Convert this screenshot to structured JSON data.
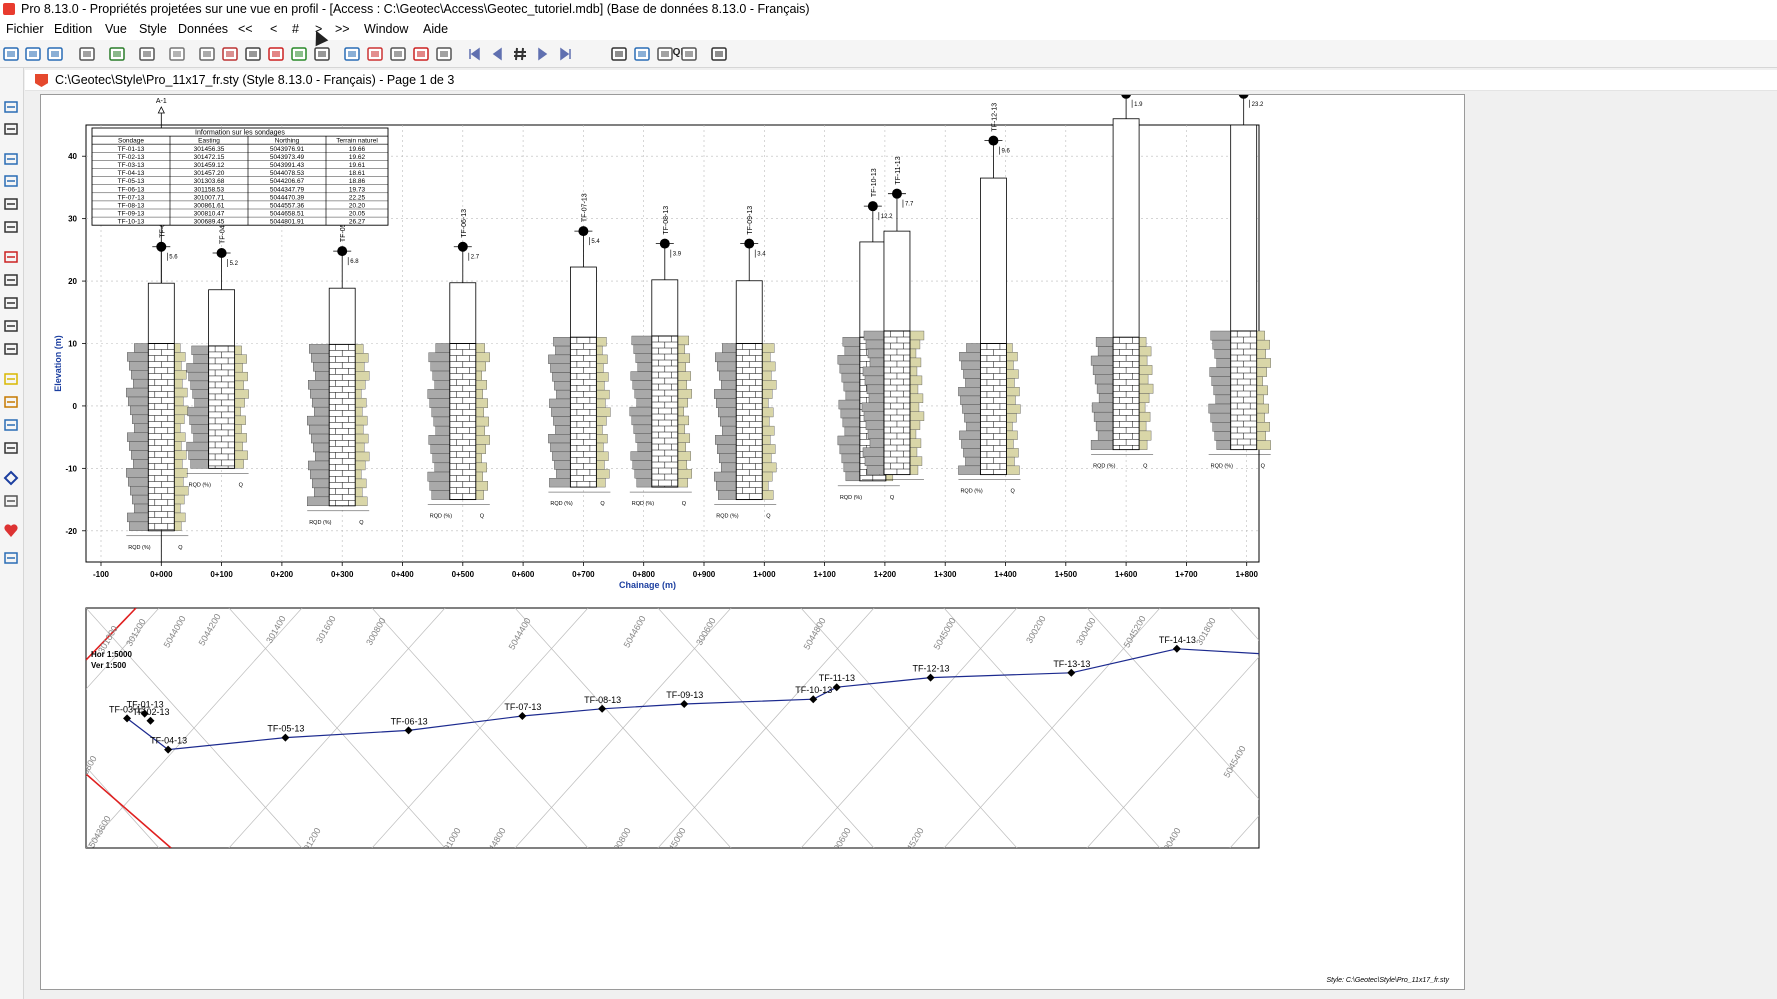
{
  "window": {
    "title": "Pro 8.13.0 - Propriétés projetées sur une vue en profil - [Access : C:\\Geotec\\Access\\Geotec_tutoriel.mdb] (Base de données 8.13.0 - Français)"
  },
  "menu": [
    "Fichier",
    "Edition",
    "Vue",
    "Style",
    "Données",
    "<<",
    "<",
    "#",
    ">",
    ">>",
    "Window",
    "Aide"
  ],
  "toolbar": {
    "icons": [
      "open-folder-icon",
      "database-icon",
      "database-link-icon",
      "print-icon",
      "refresh-icon",
      "chart-edit-icon",
      "table-icon",
      "hatch-icon",
      "curve-icon",
      "contour-icon",
      "bars-icon",
      "legend-icon",
      "cylinder-icon",
      "import-icon",
      "export-icon",
      "grid-icon",
      "zoom-region-icon",
      "dots-icon",
      "first-page-icon",
      "prev-page-icon",
      "page-number-icon",
      "next-page-icon",
      "last-page-icon",
      "sql-icon",
      "query-icon",
      "copy-icon",
      "clipboard-icon",
      "exit-icon"
    ],
    "sql_label": "SQL"
  },
  "document": {
    "title": "C:\\Geotec\\Style\\Pro_11x17_fr.sty (Style 8.13.0 - Français) - Page 1 de 3"
  },
  "chart_data": [
    {
      "type": "table",
      "title": "Information sur les sondages",
      "columns": [
        "Sondage",
        "Easting",
        "Northing",
        "Terrain naturel"
      ],
      "rows": [
        [
          "TF-01-13",
          "301456.35",
          "5043976.91",
          "19.66"
        ],
        [
          "TF-02-13",
          "301472.15",
          "5043973.49",
          "19.62"
        ],
        [
          "TF-03-13",
          "301459.12",
          "5043991.43",
          "19.61"
        ],
        [
          "TF-04-13",
          "301457.20",
          "5044078.53",
          "18.61"
        ],
        [
          "TF-05-13",
          "301303.68",
          "5044206.67",
          "18.86"
        ],
        [
          "TF-06-13",
          "301158.53",
          "5044347.79",
          "19.73"
        ],
        [
          "TF-07-13",
          "301007.71",
          "5044470.39",
          "22.25"
        ],
        [
          "TF-08-13",
          "300861.61",
          "5044557.36",
          "20.20"
        ],
        [
          "TF-09-13",
          "300810.47",
          "5044658.51",
          "20.05"
        ],
        [
          "TF-10-13",
          "300689.45",
          "5044801.91",
          "26.27"
        ]
      ]
    },
    {
      "type": "bar",
      "title": "",
      "xlabel": "Chainage (m)",
      "ylabel": "Elevation (m)",
      "xlim": [
        -100,
        1850
      ],
      "ylim": [
        -25,
        45
      ],
      "grid": true,
      "xticks": [
        "-100",
        "0+000",
        "0+100",
        "0+200",
        "0+300",
        "0+400",
        "0+500",
        "0+600",
        "0+700",
        "0+800",
        "0+900",
        "1+000",
        "1+100",
        "1+200",
        "1+300",
        "1+400",
        "1+500",
        "1+600",
        "1+700",
        "1+800"
      ],
      "yticks": [
        "-20",
        "-10",
        "0",
        "10",
        "20",
        "30",
        "40"
      ],
      "scale_text": [
        "Hor 1:5000",
        "Ver 1:500"
      ],
      "section_label": "A-1",
      "boreholes": [
        {
          "name": "TF-01-13",
          "x": 0,
          "top": 19.66,
          "bottom": -20,
          "water_label": "5.6",
          "water": 25.5,
          "rqd_label": "RQD (%)",
          "q_label": "Q"
        },
        {
          "name": "TF-04-13",
          "x": 100,
          "top": 18.61,
          "bottom": -10,
          "water_label": "5.2",
          "water": 24.5,
          "rqd_label": "RQD (%)",
          "q_label": "Q"
        },
        {
          "name": "TF-05-13",
          "x": 300,
          "top": 18.86,
          "bottom": -16,
          "water_label": "6.8",
          "water": 24.8,
          "rqd_label": "RQD (%)",
          "q_label": "Q"
        },
        {
          "name": "TF-06-13",
          "x": 500,
          "top": 19.73,
          "bottom": -15,
          "water_label": "2.7",
          "water": 25.5,
          "rqd_label": "RQD (%)",
          "q_label": "Q"
        },
        {
          "name": "TF-07-13",
          "x": 700,
          "top": 22.25,
          "bottom": -13,
          "water_label": "5.4",
          "water": 28.0,
          "rqd_label": "RQD (%)",
          "q_label": "Q"
        },
        {
          "name": "TF-08-13",
          "x": 835,
          "top": 20.2,
          "bottom": -13,
          "water_label": "3.9",
          "water": 26.0,
          "rqd_label": "RQD (%)",
          "q_label": "Q"
        },
        {
          "name": "TF-09-13",
          "x": 975,
          "top": 20.05,
          "bottom": -15,
          "water_label": "3.4",
          "water": 26.0,
          "rqd_label": "RQD (%)",
          "q_label": "Q"
        },
        {
          "name": "TF-10-13",
          "x": 1180,
          "top": 26.27,
          "bottom": -12,
          "water_label": "12.2",
          "water": 32.0,
          "rqd_label": "RQD (%)",
          "q_label": "Q"
        },
        {
          "name": "TF-11-13",
          "x": 1220,
          "top": 28.0,
          "bottom": -11,
          "water_label": "7.7",
          "water": 34.0,
          "rqd_label": "",
          "q_label": ""
        },
        {
          "name": "TF-12-13",
          "x": 1380,
          "top": 36.5,
          "bottom": -11,
          "water_label": "9.6",
          "water": 42.5,
          "rqd_label": "RQD (%)",
          "q_label": "Q"
        },
        {
          "name": "TF-13-13",
          "x": 1600,
          "top": 46.0,
          "bottom": -7,
          "water_label": "1.9",
          "water": 50.0,
          "rqd_label": "RQD (%)",
          "q_label": "Q"
        },
        {
          "name": "TF-14-13",
          "x": 1795,
          "top": 45.0,
          "bottom": -7,
          "water_label": "23.2",
          "water": 50.0,
          "rqd_label": "RQD (%)",
          "q_label": "Q"
        }
      ]
    },
    {
      "type": "scatter",
      "title": "",
      "grid_labels": [
        "301000",
        "301200",
        "5044000",
        "5044200",
        "301400",
        "301600",
        "5043800",
        "300800",
        "5044400",
        "5044600",
        "300600",
        "5044800",
        "5045000",
        "300200",
        "300400",
        "5045200",
        "301800",
        "5045400",
        "5043600",
        "301200",
        "301000",
        "5044800",
        "300800",
        "5045000",
        "300600",
        "5045200",
        "300400"
      ],
      "points": [
        {
          "name": "TF-01-13",
          "px": 0.05,
          "py": 0.44
        },
        {
          "name": "TF-02-13",
          "px": 0.055,
          "py": 0.47
        },
        {
          "name": "TF-03-13",
          "px": 0.035,
          "py": 0.46
        },
        {
          "name": "TF-04-13",
          "px": 0.07,
          "py": 0.59
        },
        {
          "name": "TF-05-13",
          "px": 0.17,
          "py": 0.54
        },
        {
          "name": "TF-06-13",
          "px": 0.275,
          "py": 0.51
        },
        {
          "name": "TF-07-13",
          "px": 0.372,
          "py": 0.45
        },
        {
          "name": "TF-08-13",
          "px": 0.44,
          "py": 0.42
        },
        {
          "name": "TF-09-13",
          "px": 0.51,
          "py": 0.4
        },
        {
          "name": "TF-10-13",
          "px": 0.62,
          "py": 0.38
        },
        {
          "name": "TF-11-13",
          "px": 0.64,
          "py": 0.33
        },
        {
          "name": "TF-12-13",
          "px": 0.72,
          "py": 0.29
        },
        {
          "name": "TF-13-13",
          "px": 0.84,
          "py": 0.27
        },
        {
          "name": "TF-14-13",
          "px": 0.93,
          "py": 0.17
        }
      ]
    }
  ],
  "footer": {
    "style_path": "Style: C:\\Geotec\\Style\\Pro_11x17_fr.sty"
  },
  "colors": {
    "axis_title": "#1c3fa0",
    "alignment_line": "#1c2a8f",
    "boundary_line": "#e02020",
    "rock_gray": "#a9a9a9",
    "rock_tan": "#d9d6a8"
  }
}
